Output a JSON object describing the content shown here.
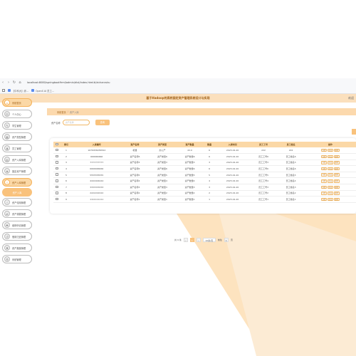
{
  "browser": {
    "url": "localhost:8080/springboot9rml/admin/dist/index.html#/zichanruku",
    "bookmarks": [
      "【中科大】综...",
      "OpenS AI 员工..."
    ]
  },
  "header": {
    "title": "基于Hadoop的高校固定资产管理系统设计与实现",
    "right": "欢迎"
  },
  "sidebar": {
    "items": [
      {
        "label": "系统首页",
        "icon": "home-icon",
        "state": "active"
      },
      {
        "label": "个人中心",
        "icon": "user-icon",
        "state": "normal"
      },
      {
        "label": "学生管理",
        "icon": "student-icon",
        "state": "normal"
      },
      {
        "label": "资产类型管理",
        "icon": "type-icon",
        "state": "normal"
      },
      {
        "label": "员工管理",
        "icon": "staff-icon",
        "state": "normal"
      },
      {
        "label": "资产入库管理",
        "icon": "store-icon",
        "state": "normal"
      },
      {
        "label": "固定资产管理",
        "icon": "asset-icon",
        "state": "normal"
      },
      {
        "label": "资产入库管理",
        "icon": "inbound-icon",
        "state": "active"
      },
      {
        "label": "资产入库",
        "icon": "",
        "state": "current"
      },
      {
        "label": "资产领用管理",
        "icon": "use-icon",
        "state": "normal"
      },
      {
        "label": "资产调拨管理",
        "icon": "transfer-icon",
        "state": "normal"
      },
      {
        "label": "维修申请管理",
        "icon": "repair-icon",
        "state": "normal"
      },
      {
        "label": "借用归还管理",
        "icon": "borrow-icon",
        "state": "normal"
      },
      {
        "label": "资产报废管理",
        "icon": "scrap-icon",
        "state": "normal"
      },
      {
        "label": "系统管理",
        "icon": "system-icon",
        "state": "normal"
      }
    ]
  },
  "breadcrumb": {
    "home": "系统首页",
    "current": "资产入库"
  },
  "search": {
    "label": "资产名称",
    "placeholder": "资产名称",
    "button": "查询"
  },
  "table": {
    "headers": [
      "",
      "索引",
      "入库编号",
      "资产名称",
      "资产类型",
      "资产数量",
      "数量",
      "入库时间",
      "员工工号",
      "员工姓名",
      "操作"
    ],
    "rows": [
      [
        "1",
        "1676956956594",
        "机器",
        "办公产",
        "22.0",
        "6",
        "2023-02-20",
        "222",
        "222"
      ],
      [
        "2",
        "666666666",
        "资产名称6",
        "资产类型6",
        "资产数量6",
        "6",
        "2023-02-20",
        "员工工号6",
        "员工姓名6"
      ],
      [
        "3",
        "7777777777",
        "资产名称3",
        "资产类型3",
        "资产数量3",
        "3",
        "2023-02-20",
        "员工工号3",
        "员工姓名3"
      ],
      [
        "4",
        "6666666666",
        "资产名称6",
        "资产类型6",
        "资产数量6",
        "6",
        "2023-02-20",
        "员工工号6",
        "员工姓名6"
      ],
      [
        "5",
        "5555555555",
        "资产名称5",
        "资产类型5",
        "资产数量5",
        "5",
        "2023-02-20",
        "员工工号5",
        "员工姓名5"
      ],
      [
        "6",
        "4444444444",
        "资产名称4",
        "资产类型4",
        "资产数量4",
        "4",
        "2023-02-20",
        "员工工号4",
        "员工姓名4"
      ],
      [
        "7",
        "3333333333",
        "资产名称3",
        "资产类型3",
        "资产数量3",
        "3",
        "2023-02-20",
        "员工工号3",
        "员工姓名3"
      ],
      [
        "8",
        "2222222222",
        "资产名称2",
        "资产类型2",
        "资产数量2",
        "2",
        "2023-02-20",
        "员工工号2",
        "员工姓名2"
      ],
      [
        "9",
        "1111111111",
        "资产名称1",
        "资产类型1",
        "资产数量1",
        "1",
        "2023-02-20",
        "员工工号1",
        "员工姓名1"
      ]
    ],
    "ops": [
      "详情",
      "修改",
      "删除"
    ]
  },
  "pager": {
    "total": "共 9 条",
    "page": "1",
    "size": "10条/页",
    "goto": "前往",
    "goto_page": "1",
    "unit": "页"
  }
}
